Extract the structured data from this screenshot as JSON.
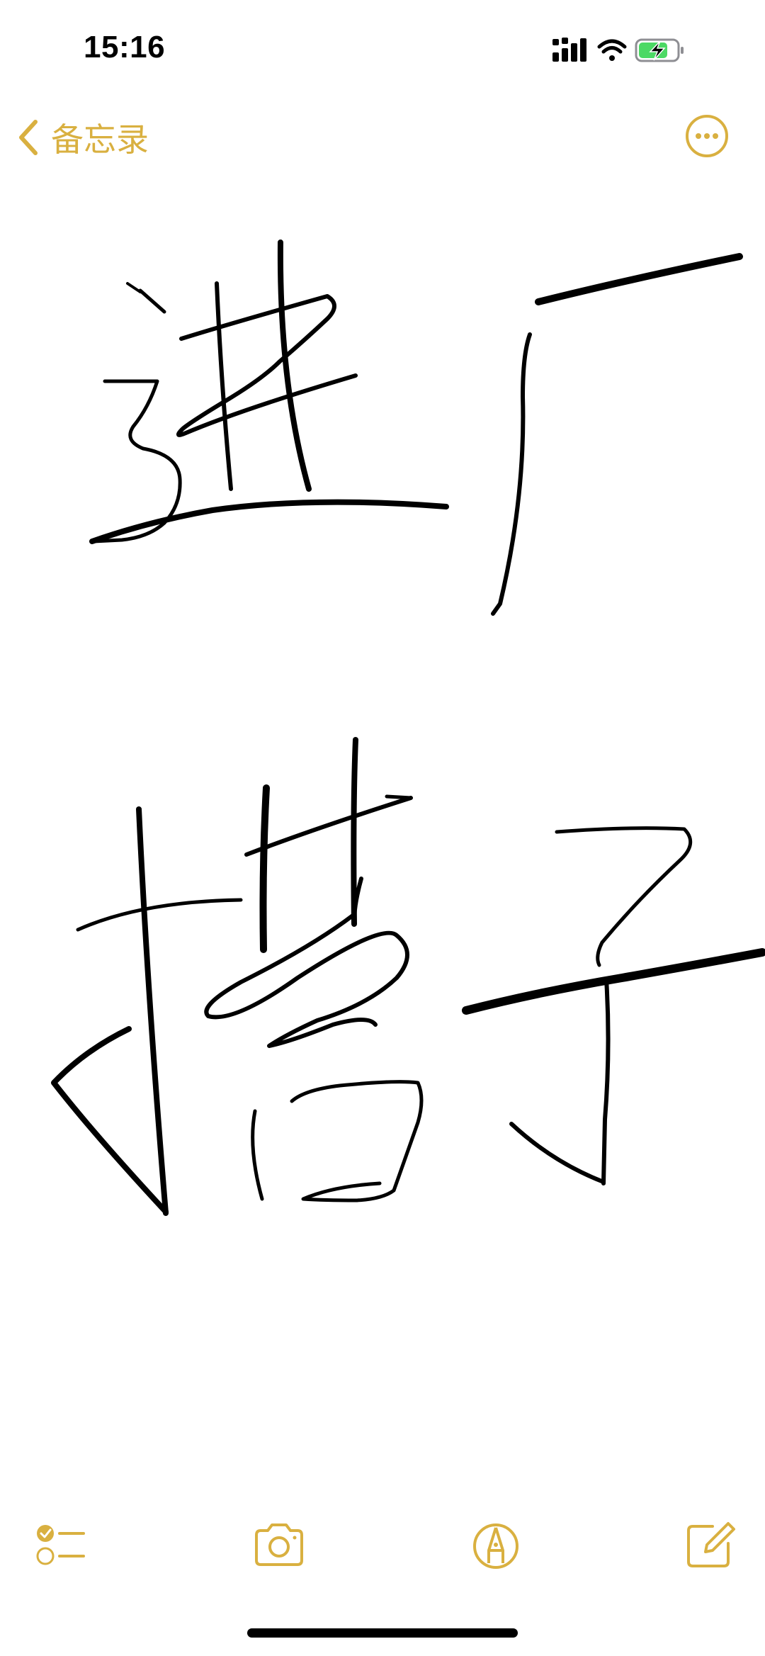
{
  "status_bar": {
    "time": "15:16"
  },
  "nav": {
    "back_label": "备忘录"
  },
  "colors": {
    "accent": "#d9b040",
    "ink": "#000000",
    "battery_fill": "#4cd964"
  },
  "icons": {
    "back": "chevron-left-icon",
    "more": "ellipsis-circle-icon",
    "checklist": "checklist-icon",
    "camera": "camera-icon",
    "markup": "pen-tip-icon",
    "compose": "compose-icon"
  },
  "note": {
    "handwritten_text": "进厂措子"
  }
}
